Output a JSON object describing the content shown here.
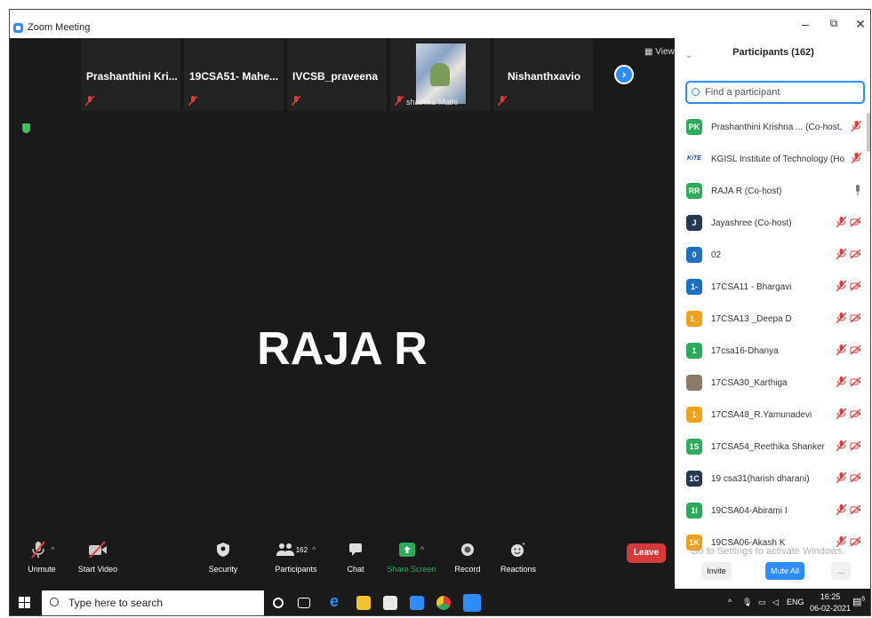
{
  "window": {
    "title": "Zoom Meeting",
    "minimize": "–",
    "restore": "⧉",
    "close": "✕"
  },
  "gallery": {
    "thumbs": [
      {
        "name": "Prashanthini  Kri..."
      },
      {
        "name": "19CSA51- Mahe..."
      },
      {
        "name": "IVCSB_praveena"
      },
      {
        "name": "shathika Mathi"
      },
      {
        "name": "Nishanthxavio"
      }
    ],
    "next_label": "›",
    "view_label": "View"
  },
  "speaker": {
    "name": "RAJA R"
  },
  "toolbar": {
    "unmute": "Unmute",
    "start_video": "Start Video",
    "security": "Security",
    "participants": "Participants",
    "participants_count": "162",
    "chat": "Chat",
    "share_screen": "Share Screen",
    "record": "Record",
    "reactions": "Reactions",
    "leave": "Leave"
  },
  "panel": {
    "title": "Participants (162)",
    "search_placeholder": "Find a participant",
    "participants": [
      {
        "initials": "PK",
        "name": "Prashanthini Krishna ...  (Co-host, me)",
        "color": "#2eaa5c",
        "icons": "mute"
      },
      {
        "initials": "KiTE",
        "name": "KGISL Institute of Technology (Host)",
        "color": "#ffffff",
        "icons": "mute"
      },
      {
        "initials": "RR",
        "name": "RAJA R (Co-host)",
        "color": "#2eaa5c",
        "icons": "mic"
      },
      {
        "initials": "J",
        "name": "Jayashree (Co-host)",
        "color": "#26394f",
        "icons": "both"
      },
      {
        "initials": "0",
        "name": "02",
        "color": "#1f6fc1",
        "icons": "both"
      },
      {
        "initials": "1-",
        "name": "17CSA11 - Bhargavi",
        "color": "#1f6fc1",
        "icons": "both"
      },
      {
        "initials": "1_",
        "name": "17CSA13 _Deepa D",
        "color": "#f0a020",
        "icons": "both"
      },
      {
        "initials": "1",
        "name": "17csa16-Dhanya",
        "color": "#2eaa5c",
        "icons": "both"
      },
      {
        "initials": "",
        "name": "17CSA30_Karthiga",
        "color": "#8a7a6a",
        "icons": "both"
      },
      {
        "initials": "1",
        "name": "17CSA48_R.Yamunadevi",
        "color": "#f0a020",
        "icons": "both"
      },
      {
        "initials": "1S",
        "name": "17CSA54_Reethika Shanker",
        "color": "#2eaa5c",
        "icons": "both"
      },
      {
        "initials": "1C",
        "name": "19 csa31(harish dharani)",
        "color": "#26394f",
        "icons": "both"
      },
      {
        "initials": "1I",
        "name": "19CSA04-Abirami I",
        "color": "#2eaa5c",
        "icons": "both"
      },
      {
        "initials": "1K",
        "name": "19CSA06-Akash K",
        "color": "#f0a020",
        "icons": "both"
      }
    ],
    "watermark": "Go to Settings to activate Windows.",
    "invite": "Invite",
    "mute_all": "Mute All",
    "more": "..."
  },
  "taskbar": {
    "search_placeholder": "Type here to search",
    "lang": "ENG",
    "time": "16:25",
    "date": "06-02-2021",
    "notif_count": "5"
  },
  "colors": {
    "accent": "#2d8cff",
    "leave": "#d63b3b",
    "muted": "#e03c3c",
    "share": "#2eaa5c"
  }
}
